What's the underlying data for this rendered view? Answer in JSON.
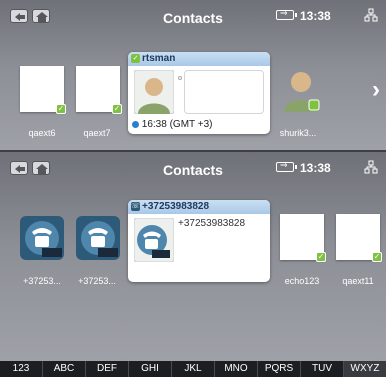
{
  "screens": [
    {
      "title": "Contacts",
      "time": "13:38",
      "contacts": [
        {
          "label": "qaext6"
        },
        {
          "label": "qaext7"
        },
        {
          "label": "shurik3..."
        }
      ],
      "card": {
        "name": "rtsman",
        "status": "16:38 (GMT +3)"
      }
    },
    {
      "title": "Contacts",
      "time": "13:38",
      "contacts": [
        {
          "label": "+37253..."
        },
        {
          "label": "+37253..."
        },
        {
          "label": "echo123"
        },
        {
          "label": "qaext11"
        }
      ],
      "card": {
        "name": "+37253983828",
        "number": "+37253983828"
      }
    }
  ],
  "keyboard": {
    "keys": [
      "123",
      "ABC",
      "DEF",
      "GHI",
      "JKL",
      "MNO",
      "PQRS",
      "TUV",
      "WXYZ"
    ],
    "active": "WXYZ"
  },
  "icons": [
    "back-icon",
    "home-icon",
    "battery-icon",
    "network-icon",
    "next-arrow-icon",
    "online-status-icon",
    "phone-icon"
  ]
}
